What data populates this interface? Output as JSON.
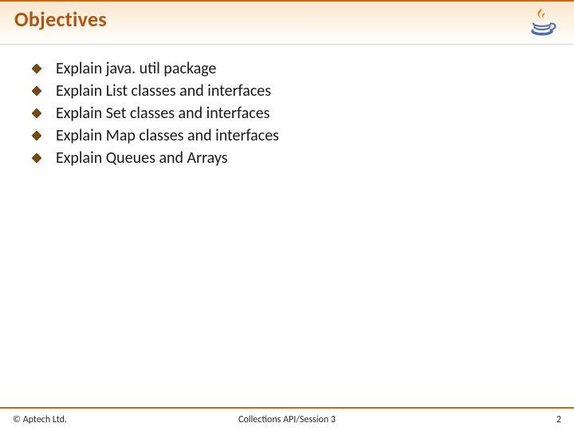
{
  "header": {
    "title": "Objectives",
    "logo_name": "java-logo"
  },
  "objectives": [
    "Explain java. util package",
    "Explain List classes and interfaces",
    "Explain Set classes and interfaces",
    "Explain Map classes and interfaces",
    "Explain Queues and Arrays"
  ],
  "footer": {
    "left": "© Aptech Ltd.",
    "center": "Collections API/Session 3",
    "right": "2"
  },
  "colors": {
    "accent": "#b35410",
    "rule": "#c56a17"
  }
}
